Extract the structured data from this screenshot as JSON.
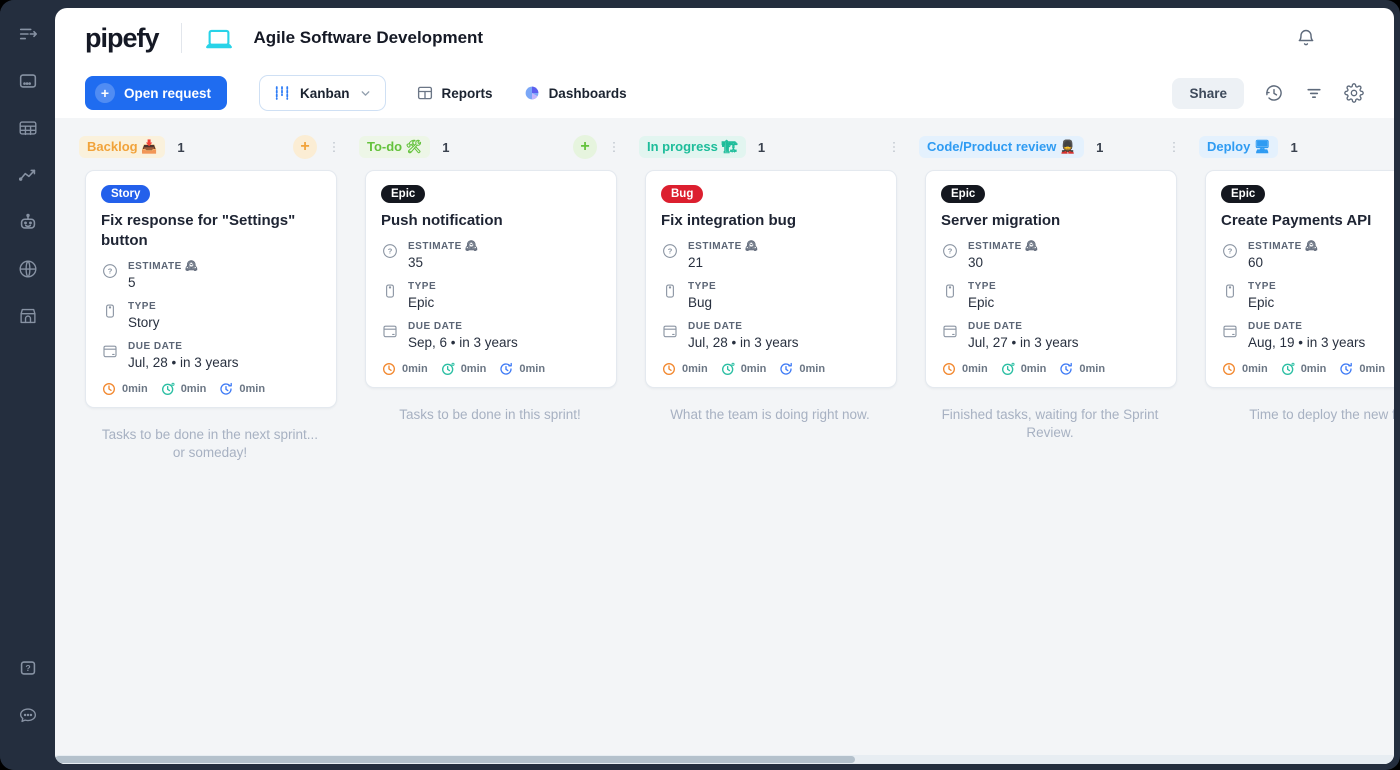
{
  "app": {
    "logo_text": "pipefy",
    "pipe_title": "Agile Software Development"
  },
  "header": {
    "bell_icon": "notifications-bell-icon"
  },
  "toolbar": {
    "open_request_label": "Open request",
    "view_selector_label": "Kanban",
    "reports_label": "Reports",
    "dashboards_label": "Dashboards",
    "share_label": "Share",
    "right_icons": [
      "history",
      "filter",
      "settings"
    ]
  },
  "sidebar": {
    "top_icons": [
      "collapse-menu",
      "pipes",
      "database",
      "analytics",
      "automation",
      "portals",
      "marketplace"
    ],
    "bottom_icons": [
      "help-center",
      "support-chat"
    ]
  },
  "board": {
    "field_labels": {
      "estimate": "ESTIMATE",
      "estimate_emoji": "🕰",
      "type": "TYPE",
      "due_date": "DUE DATE"
    },
    "timer_colors": [
      "#F2882F",
      "#2BBFA3",
      "#3F7BF6"
    ],
    "columns": [
      {
        "label": "Backlog",
        "emoji": "📥",
        "count": "1",
        "accent": "#F1A33B",
        "pill_bg": "#FAF1DC",
        "add_bg": "#FBEDD4",
        "has_add": true,
        "has_menu": true,
        "description": "Tasks to be done in the next sprint... or someday!",
        "cards": [
          {
            "badge": "Story",
            "badge_bg": "#2360EB",
            "title": "Fix response for \"Settings\" button",
            "estimate": "5",
            "type": "Story",
            "due_date": "Jul, 28 • in 3 years",
            "timers": [
              "0min",
              "0min",
              "0min"
            ]
          }
        ]
      },
      {
        "label": "To-do",
        "emoji": "🛠",
        "count": "1",
        "accent": "#64C23C",
        "pill_bg": "#EDF6E7",
        "add_bg": "#E6F4DE",
        "has_add": true,
        "has_menu": true,
        "description": "Tasks to be done in this sprint!",
        "cards": [
          {
            "badge": "Epic",
            "badge_bg": "#14171F",
            "title": "Push notification",
            "estimate": "35",
            "type": "Epic",
            "due_date": "Sep, 6 • in 3 years",
            "timers": [
              "0min",
              "0min",
              "0min"
            ]
          }
        ]
      },
      {
        "label": "In progress",
        "emoji": "🏗",
        "count": "1",
        "accent": "#1DBD9A",
        "pill_bg": "#E2F5F0",
        "add_bg": "#DFF3ED",
        "has_add": false,
        "has_menu": true,
        "description": "What the team is doing right now.",
        "cards": [
          {
            "badge": "Bug",
            "badge_bg": "#DC1F2F",
            "title": "Fix integration bug",
            "estimate": "21",
            "type": "Bug",
            "due_date": "Jul, 28 • in 3 years",
            "timers": [
              "0min",
              "0min",
              "0min"
            ]
          }
        ]
      },
      {
        "label": "Code/Product review",
        "emoji": "💂",
        "count": "1",
        "accent": "#2E9BF2",
        "pill_bg": "#E4F1FD",
        "add_bg": "#DFEEFC",
        "has_add": false,
        "has_menu": true,
        "description": "Finished tasks, waiting for the Sprint Review.",
        "cards": [
          {
            "badge": "Epic",
            "badge_bg": "#14171F",
            "title": "Server migration",
            "estimate": "30",
            "type": "Epic",
            "due_date": "Jul, 27 • in 3 years",
            "timers": [
              "0min",
              "0min",
              "0min"
            ]
          }
        ]
      },
      {
        "label": "Deploy",
        "emoji": "🖥",
        "count": "1",
        "accent": "#2E9BF2",
        "pill_bg": "#E4F1FD",
        "add_bg": "#DFEEFC",
        "has_add": false,
        "has_menu": false,
        "description": "Time to deploy the new fea",
        "cards": [
          {
            "badge": "Epic",
            "badge_bg": "#14171F",
            "title": "Create Payments API",
            "estimate": "60",
            "type": "Epic",
            "due_date": "Aug, 19 • in 3 years",
            "timers": [
              "0min",
              "0min",
              "0min"
            ]
          }
        ]
      }
    ]
  }
}
